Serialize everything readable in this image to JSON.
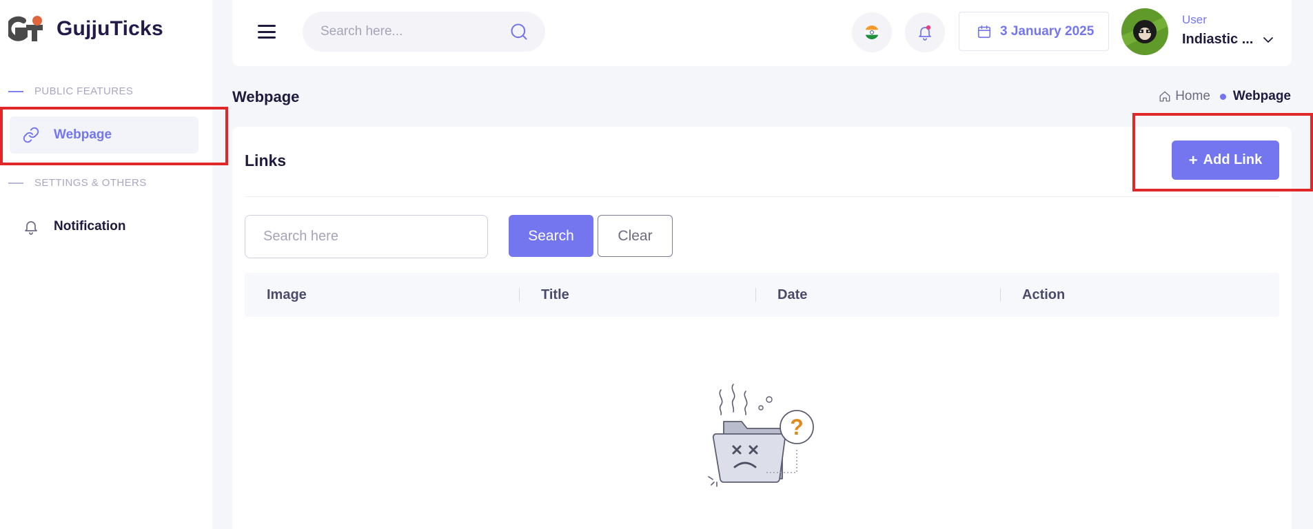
{
  "app": {
    "name": "GujjuTicks"
  },
  "sidebar": {
    "sections": [
      {
        "label": "PUBLIC FEATURES"
      },
      {
        "label": "SETTINGS & OTHERS"
      }
    ],
    "items": [
      {
        "label": "Webpage",
        "icon": "link-icon",
        "active": true
      },
      {
        "label": "Notification",
        "icon": "bell-icon",
        "active": false
      }
    ]
  },
  "header": {
    "search_placeholder": "Search here...",
    "date": "3 January 2025",
    "user_role": "User",
    "user_name": "Indiastic ..."
  },
  "page": {
    "title": "Webpage",
    "breadcrumb": {
      "home": "Home",
      "current": "Webpage"
    }
  },
  "card": {
    "title": "Links",
    "add_button": "Add Link",
    "filter_placeholder": "Search here",
    "search_button": "Search",
    "clear_button": "Clear",
    "columns": [
      "Image",
      "Title",
      "Date",
      "Action"
    ]
  },
  "colors": {
    "accent": "#7376ee",
    "highlight": "#e0282a",
    "background": "#f5f6fa"
  }
}
